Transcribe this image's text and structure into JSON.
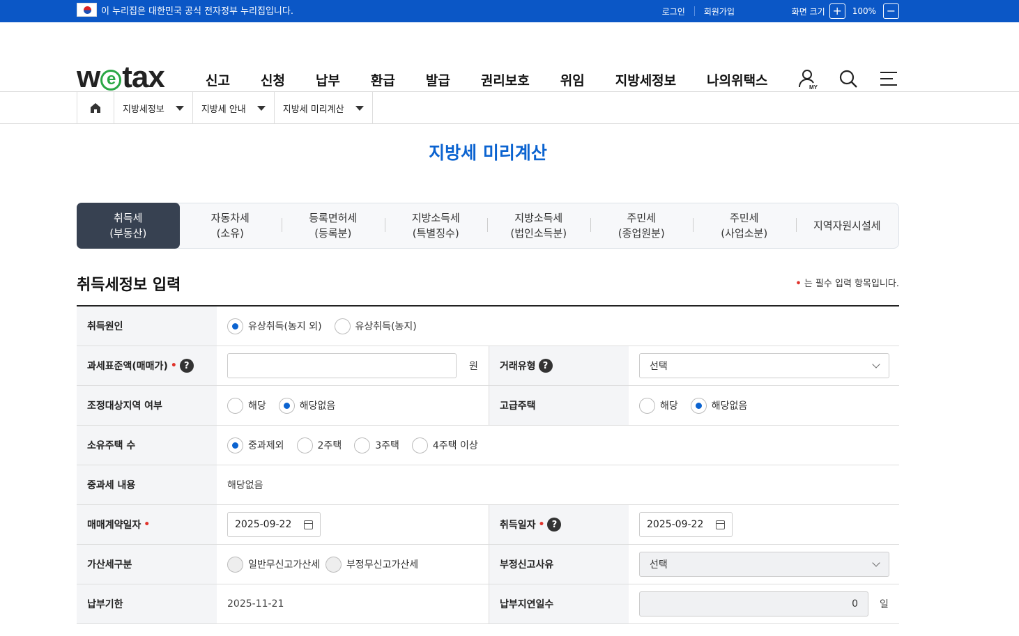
{
  "topbar": {
    "gov_notice": "이 누리집은 대한민국 공식 전자정부 누리집입니다.",
    "login": "로그인",
    "signup": "회원가입",
    "screen_size": "화면 크기",
    "zoom_level": "100%",
    "zoom_in": "+",
    "zoom_out": "−"
  },
  "header": {
    "logo_pre": "w",
    "logo_e": "e",
    "logo_post": "tax",
    "nav": [
      "신고",
      "신청",
      "납부",
      "환급",
      "발급",
      "권리보호",
      "위임",
      "지방세정보",
      "나의위택스"
    ],
    "my_label": "MY"
  },
  "breadcrumb": [
    "지방세정보",
    "지방세 안내",
    "지방세 미리계산"
  ],
  "page_title": "지방세 미리계산",
  "tabs": [
    {
      "line1": "취득세",
      "line2": "(부동산)"
    },
    {
      "line1": "자동차세",
      "line2": "(소유)"
    },
    {
      "line1": "등록면허세",
      "line2": "(등록분)"
    },
    {
      "line1": "지방소득세",
      "line2": "(특별징수)"
    },
    {
      "line1": "지방소득세",
      "line2": "(법인소득분)"
    },
    {
      "line1": "주민세",
      "line2": "(종업원분)"
    },
    {
      "line1": "주민세",
      "line2": "(사업소분)"
    },
    {
      "line1": "지역자원시설세",
      "line2": ""
    }
  ],
  "section": {
    "title": "취득세정보 입력",
    "required_note": "는 필수 입력 항목입니다.",
    "required_mark": "•"
  },
  "form": {
    "cause": {
      "label": "취득원인",
      "options": [
        "유상취득(농지 외)",
        "유상취득(농지)"
      ]
    },
    "base": {
      "label": "과세표준액(매매가)",
      "unit": "원"
    },
    "deal_type": {
      "label": "거래유형",
      "value": "선택"
    },
    "adjust": {
      "label": "조정대상지역 여부",
      "options": [
        "해당",
        "해당없음"
      ]
    },
    "luxury": {
      "label": "고급주택",
      "options": [
        "해당",
        "해당없음"
      ]
    },
    "houses": {
      "label": "소유주택 수",
      "options": [
        "중과제외",
        "2주택",
        "3주택",
        "4주택 이상"
      ]
    },
    "heavy": {
      "label": "중과세 내용",
      "value": "해당없음"
    },
    "contract_date": {
      "label": "매매계약일자",
      "value": "2025-09-22"
    },
    "acq_date": {
      "label": "취득일자",
      "value": "2025-09-22"
    },
    "penalty": {
      "label": "가산세구분",
      "options": [
        "일반무신고가산세",
        "부정무신고가산세"
      ]
    },
    "fraud_reason": {
      "label": "부정신고사유",
      "value": "선택"
    },
    "due": {
      "label": "납부기한",
      "value": "2025-11-21"
    },
    "delay": {
      "label": "납부지연일수",
      "value": "0",
      "unit": "일"
    }
  },
  "colors": {
    "accent": "#0b63d0",
    "topbar": "#0b57c6",
    "active_tab": "#374151"
  }
}
